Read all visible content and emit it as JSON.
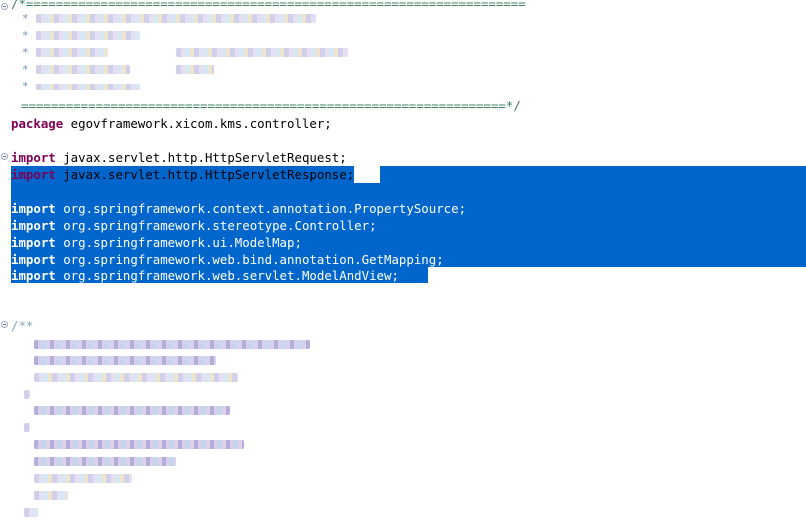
{
  "editor": {
    "header_comment": {
      "open_rule": "/*===================================================================",
      "close_rule": "=================================================================*/",
      "line_prefix": "*"
    },
    "package": {
      "keyword": "package",
      "name": " egovframework.xicom.kms.controller;"
    },
    "imports": [
      {
        "keyword": "import",
        "name": " javax.servlet.http.HttpServletRequest;",
        "selected": false
      },
      {
        "keyword": "import",
        "name": " javax.servlet.http.HttpServletResponse;",
        "selected": true
      },
      {
        "keyword": "import",
        "name": " org.springframework.context.annotation.PropertySource;",
        "selected": true
      },
      {
        "keyword": "import",
        "name": " org.springframework.stereotype.Controller;",
        "selected": true
      },
      {
        "keyword": "import",
        "name": " org.springframework.ui.ModelMap;",
        "selected": true
      },
      {
        "keyword": "import",
        "name": " org.springframework.web.bind.annotation.GetMapping;",
        "selected": true
      },
      {
        "keyword": "import",
        "name": " org.springframework.web.servlet.ModelAndView;",
        "selected": true
      }
    ],
    "javadoc_open": "/**",
    "colors": {
      "keyword": "#7f0055",
      "comment": "#3f7f5f",
      "selection": "#0066cc",
      "text": "#000000"
    }
  }
}
